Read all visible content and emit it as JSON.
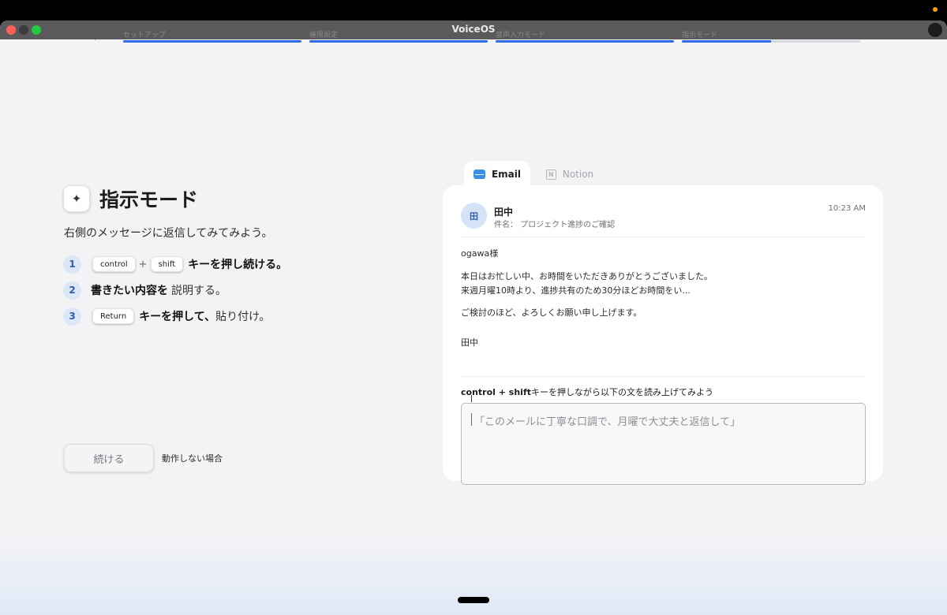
{
  "window": {
    "title": "VoiceOS"
  },
  "progress": {
    "back_label": "‹",
    "steps": [
      {
        "label": "セットアップ",
        "progress": 1.0
      },
      {
        "label": "権限設定",
        "progress": 1.0
      },
      {
        "label": "音声入力モード",
        "progress": 1.0
      },
      {
        "label": "指示モード",
        "progress": 0.5
      }
    ]
  },
  "left_panel": {
    "icon_glyph": "✦",
    "title": "指示モード",
    "subtitle": "右側のメッセージに返信してみてみよう。",
    "instructions": [
      {
        "number": "1",
        "key1": "control",
        "plus": "+",
        "key2": "shift",
        "bold": "キーを押し続ける。"
      },
      {
        "number": "2",
        "bold": "書きたい内容を",
        "text": "説明する。"
      },
      {
        "number": "3",
        "key1": "Return",
        "bold": "キーを押して、",
        "text": "貼り付け。"
      }
    ],
    "continue_label": "続ける",
    "help_label": "動作しない場合"
  },
  "tabs": [
    {
      "label": "Email",
      "active": true,
      "icon": "mail-icon"
    },
    {
      "label": "Notion",
      "active": false,
      "icon": "notion-icon",
      "icon_glyph": "N"
    }
  ],
  "email": {
    "avatar_initial": "田",
    "sender": "田中",
    "subject": "件名： プロジェクト進捗のご確認",
    "time": "10:23 AM",
    "body": [
      "ogawa様",
      "本日はお忙しい中、お時間をいただきありがとうございました。",
      "来週月曜10時より、進捗共有のため30分ほどお時間をい...",
      "ご検討のほど、よろしくお願い申し上げます。",
      "田中"
    ]
  },
  "prompt": {
    "bold": "control + shift",
    "text": "キーを押しながら以下の文を読み上げてみよう"
  },
  "reply_box": {
    "placeholder": "「このメールに丁寧な口調で、月曜で大丈夫と返信して」"
  },
  "colors": {
    "accent": "#2f6ae6",
    "step_number_bg": "#dbe6f7",
    "avatar_bg": "#d5e3f7"
  }
}
